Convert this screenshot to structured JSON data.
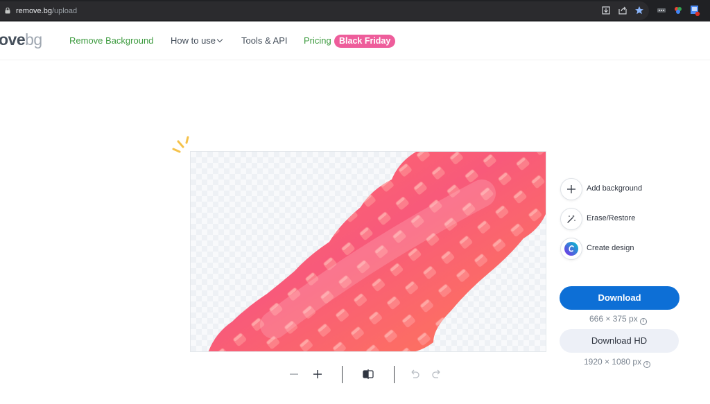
{
  "browser": {
    "url_host": "remove.bg",
    "url_path": "/upload",
    "toolbar_icons": [
      "download-icon",
      "share-icon",
      "star-icon",
      "extension-icon",
      "color-icon",
      "profile-icon"
    ]
  },
  "header": {
    "logo_dark": "ove",
    "logo_light": "bg",
    "nav": {
      "remove_background": "Remove Background",
      "how_to_use": "How to use",
      "tools_api": "Tools & API",
      "pricing": "Pricing",
      "badge": "Black Friday"
    }
  },
  "tools": {
    "add_background": "Add background",
    "erase_restore": "Erase/Restore",
    "create_design": "Create design"
  },
  "download": {
    "label": "Download",
    "size": "666 × 375 px",
    "hd_label": "Download HD",
    "hd_size": "1920 × 1080 px"
  },
  "colors": {
    "accent_green": "#3d9b3f",
    "accent_blue": "#0d6fd6",
    "badge_pink": "#ee5d9b"
  }
}
